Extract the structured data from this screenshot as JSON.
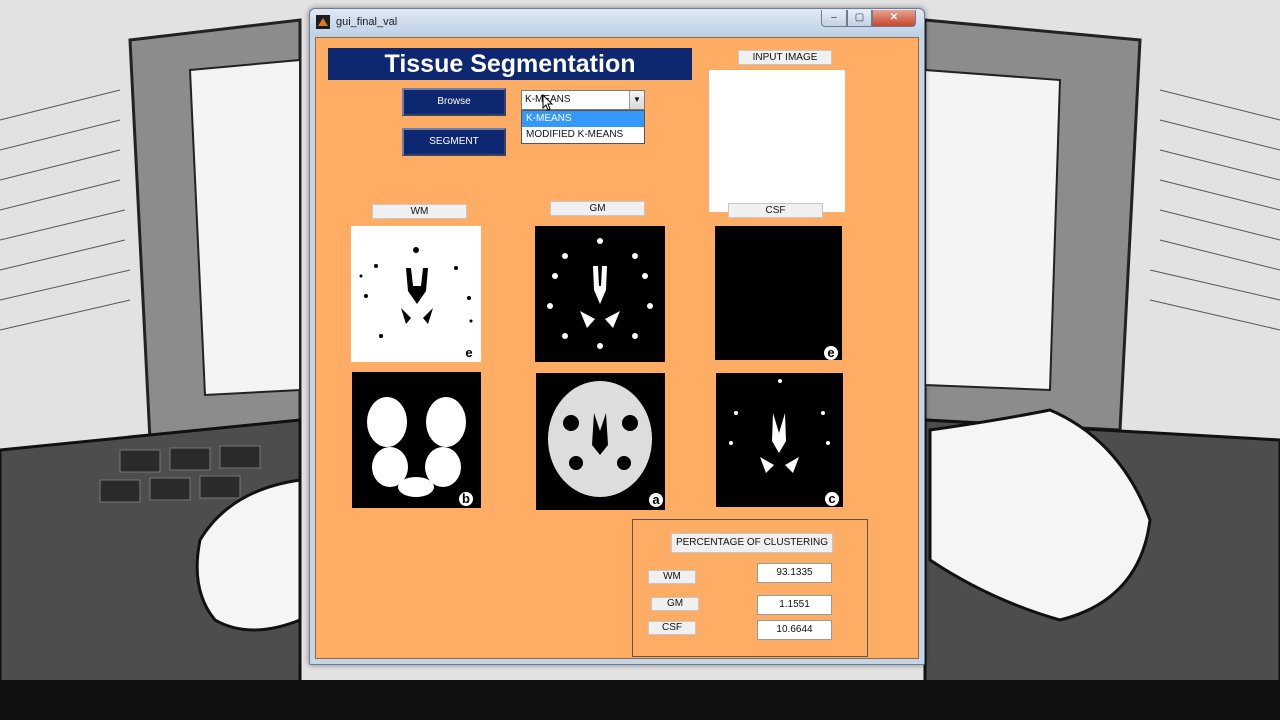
{
  "window": {
    "title": "gui_final_val",
    "controls": {
      "minimize": "–",
      "maximize": "▢",
      "close": "✕"
    }
  },
  "header": {
    "title": "Tissue Segmentation"
  },
  "buttons": {
    "browse": "Browse",
    "segment": "SEGMENT"
  },
  "method_select": {
    "selected": "K-MEANS",
    "options": [
      "K-MEANS",
      "MODIFIED K-MEANS"
    ],
    "highlighted": "K-MEANS"
  },
  "labels": {
    "input_image": "INPUT IMAGE",
    "wm": "WM",
    "gm": "GM",
    "csf": "CSF"
  },
  "panels": {
    "row1": [
      {
        "tag": "e"
      },
      {
        "tag": ""
      },
      {
        "tag": "e"
      }
    ],
    "row2": [
      {
        "tag": "b"
      },
      {
        "tag": "a"
      },
      {
        "tag": "c"
      }
    ]
  },
  "results": {
    "title": "PERCENTAGE OF CLUSTERING",
    "rows": [
      {
        "label": "WM",
        "value": "93.1335"
      },
      {
        "label": "GM",
        "value": "1.1551"
      },
      {
        "label": "CSF",
        "value": "10.6644"
      }
    ]
  },
  "colors": {
    "figure_bg": "#ffac64",
    "navy": "#0d2870",
    "highlight": "#3399ff"
  }
}
